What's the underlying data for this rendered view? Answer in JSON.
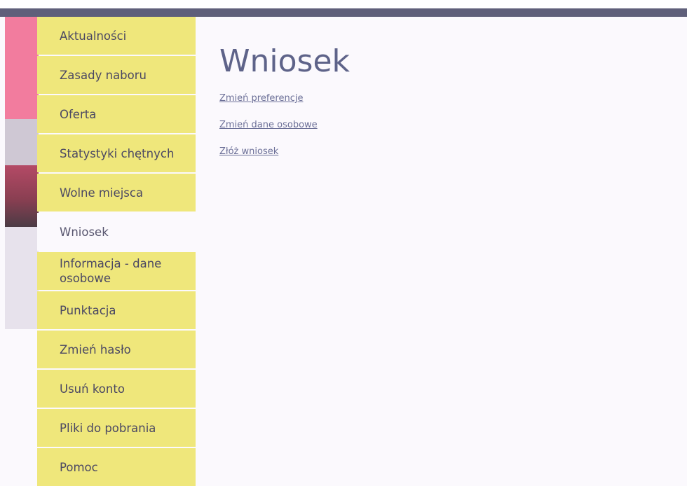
{
  "nav": {
    "items": [
      {
        "label": "Aktualności"
      },
      {
        "label": "Zasady naboru"
      },
      {
        "label": "Oferta"
      },
      {
        "label": "Statystyki chętnych"
      },
      {
        "label": "Wolne miejsca"
      },
      {
        "label": "Wniosek",
        "active": true
      },
      {
        "label": "Informacja - dane osobowe"
      },
      {
        "label": "Punktacja"
      },
      {
        "label": "Zmień hasło"
      },
      {
        "label": "Usuń konto"
      },
      {
        "label": "Pliki do pobrania"
      },
      {
        "label": "Pomoc"
      }
    ]
  },
  "main": {
    "title": "Wniosek",
    "links": [
      {
        "label": "Zmień preferencje"
      },
      {
        "label": "Zmień dane osobowe"
      },
      {
        "label": "Złóż wniosek"
      }
    ]
  },
  "colors": {
    "nav_background": "#efe77b",
    "active_background": "#fbf9fd",
    "title": "#5e6389",
    "link": "#6b6f97",
    "top_bar": "#5f5f7a",
    "decor_pink": "#f27c9e"
  }
}
